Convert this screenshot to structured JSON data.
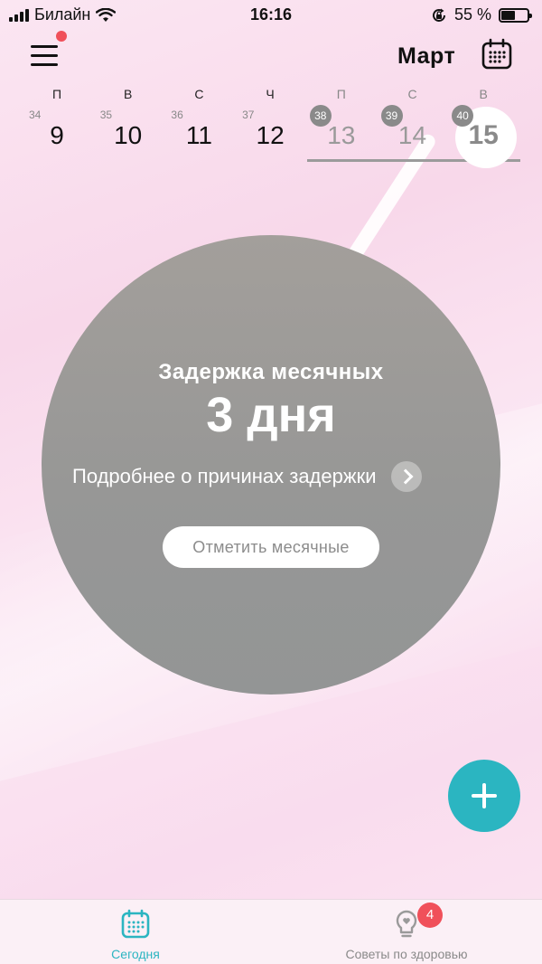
{
  "status_bar": {
    "carrier": "Билайн",
    "time": "16:16",
    "battery_percent": "55 %",
    "battery_level": 0.55
  },
  "header": {
    "month": "Март",
    "menu_has_notification": true
  },
  "week": [
    {
      "letter": "П",
      "cycle_day": "34",
      "date": "9",
      "state": "past"
    },
    {
      "letter": "В",
      "cycle_day": "35",
      "date": "10",
      "state": "past"
    },
    {
      "letter": "С",
      "cycle_day": "36",
      "date": "11",
      "state": "past"
    },
    {
      "letter": "Ч",
      "cycle_day": "37",
      "date": "12",
      "state": "past"
    },
    {
      "letter": "П",
      "cycle_day": "38",
      "date": "13",
      "state": "future"
    },
    {
      "letter": "С",
      "cycle_day": "39",
      "date": "14",
      "state": "future"
    },
    {
      "letter": "В",
      "cycle_day": "40",
      "date": "15",
      "state": "today"
    }
  ],
  "main": {
    "title": "Задержка месячных",
    "value": "3 дня",
    "reasons_link": "Подробнее о причинах задержки",
    "mark_button": "Отметить месячные"
  },
  "tabs": {
    "today_label": "Сегодня",
    "tips_label": "Советы по здоровью",
    "tips_badge": "4"
  },
  "colors": {
    "accent": "#2bb5c1",
    "badge": "#f0505a",
    "circle": "#979796"
  }
}
